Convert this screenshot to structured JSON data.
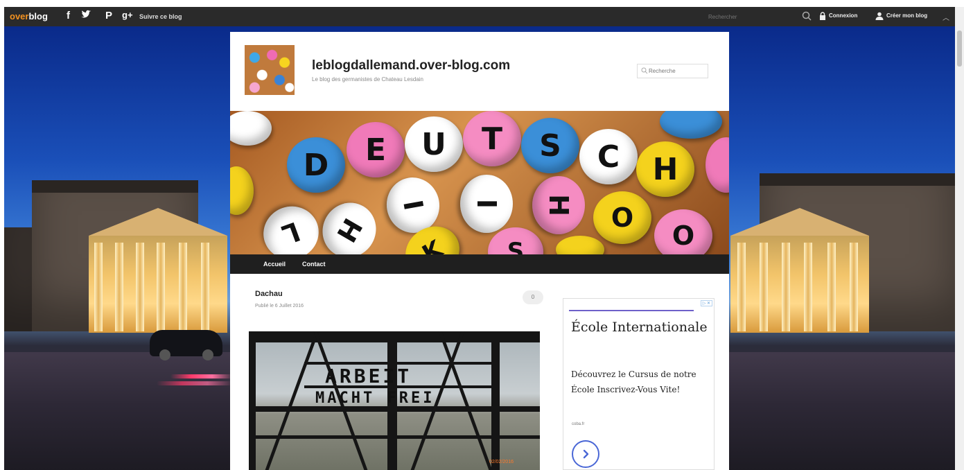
{
  "topbar": {
    "logo_prefix": "over",
    "logo_main": "blog",
    "social": [
      "f",
      "t",
      "P",
      "g+"
    ],
    "follow_label": "Suivre ce blog",
    "search_placeholder": "Rechercher",
    "login_label": "Connexion",
    "create_label": "Créer mon blog"
  },
  "blog": {
    "title": "leblogdallemand.over-blog.com",
    "subtitle": "Le blog des germanistes de Chateau Lesdain",
    "search_placeholder": "Recherche"
  },
  "banner": {
    "letters_top": [
      "D",
      "E",
      "U",
      "T",
      "S",
      "C",
      "H"
    ],
    "letters_bottom": [
      "L",
      "H",
      "I",
      "I",
      "H",
      "O",
      "O",
      "S",
      "K"
    ]
  },
  "nav": {
    "items": [
      "Accueil",
      "Contact"
    ]
  },
  "post": {
    "title": "Dachau",
    "date": "Publié le 6 Juillet 2016",
    "comment_count": "0",
    "gate_line1": "ARBEIT",
    "gate_line2": "MACHT FREI",
    "image_stamp": "02/02/2016"
  },
  "ad": {
    "title": "École Internationale",
    "body": "Découvrez le Cursus de notre École Inscrivez-Vous Vite!",
    "source": "coba.fr",
    "badge": "▷ ✕"
  },
  "colors": {
    "topbar": "#2a2a2a",
    "nav": "#1f1f1f",
    "accent_orange": "#f39220",
    "ad_accent": "#4a67d6"
  }
}
